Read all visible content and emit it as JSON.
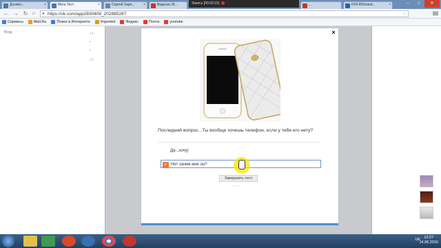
{
  "browser": {
    "tabs": [
      {
        "label": "Дэнпин...",
        "color": "#4a76a8"
      },
      {
        "label": "Мега Тест",
        "color": "#4a76a8"
      },
      {
        "label": "Сергей Харл...",
        "color": "#6b84a6"
      },
      {
        "label": "Видеонс М...",
        "color": "#c0392b"
      },
      {
        "label": "...",
        "color": "#c0392b"
      },
      {
        "label": "H24-RDmand...",
        "color": "#1f6aa5"
      }
    ],
    "recording_text": "Запись [00:03:15]",
    "url": "https://vk.com/app2830409_202885287"
  },
  "bookmarks": [
    {
      "label": "Сервисы",
      "color": "#4a7bd1"
    },
    {
      "label": "Mail.Ru",
      "color": "#f39c12"
    },
    {
      "label": "Поиск в Интернете",
      "color": "#3b7dd8"
    },
    {
      "label": "Imported",
      "color": "#d4a017"
    },
    {
      "label": "Яндекс",
      "color": "#e03c31"
    },
    {
      "label": "Почта",
      "color": "#e03c31"
    },
    {
      "label": "youtube",
      "color": "#e03c31"
    }
  ],
  "left_panel": {
    "login": "Вход"
  },
  "quiz": {
    "question": "Последний вопрос...Ты вообще хочешь телефон, если у тебя его нету?",
    "answers": [
      {
        "label": "Да...хочу)",
        "checked": false
      },
      {
        "label": "Нет зачем мне он?",
        "checked": true
      }
    ],
    "finish_label": "Завершить тест"
  },
  "taskbar": {
    "lang": "UK",
    "time": "13:27",
    "date": "14.06.2016"
  },
  "colors": {
    "checkbox_accent": "#e8773d",
    "progress": "#4d8fd1"
  }
}
